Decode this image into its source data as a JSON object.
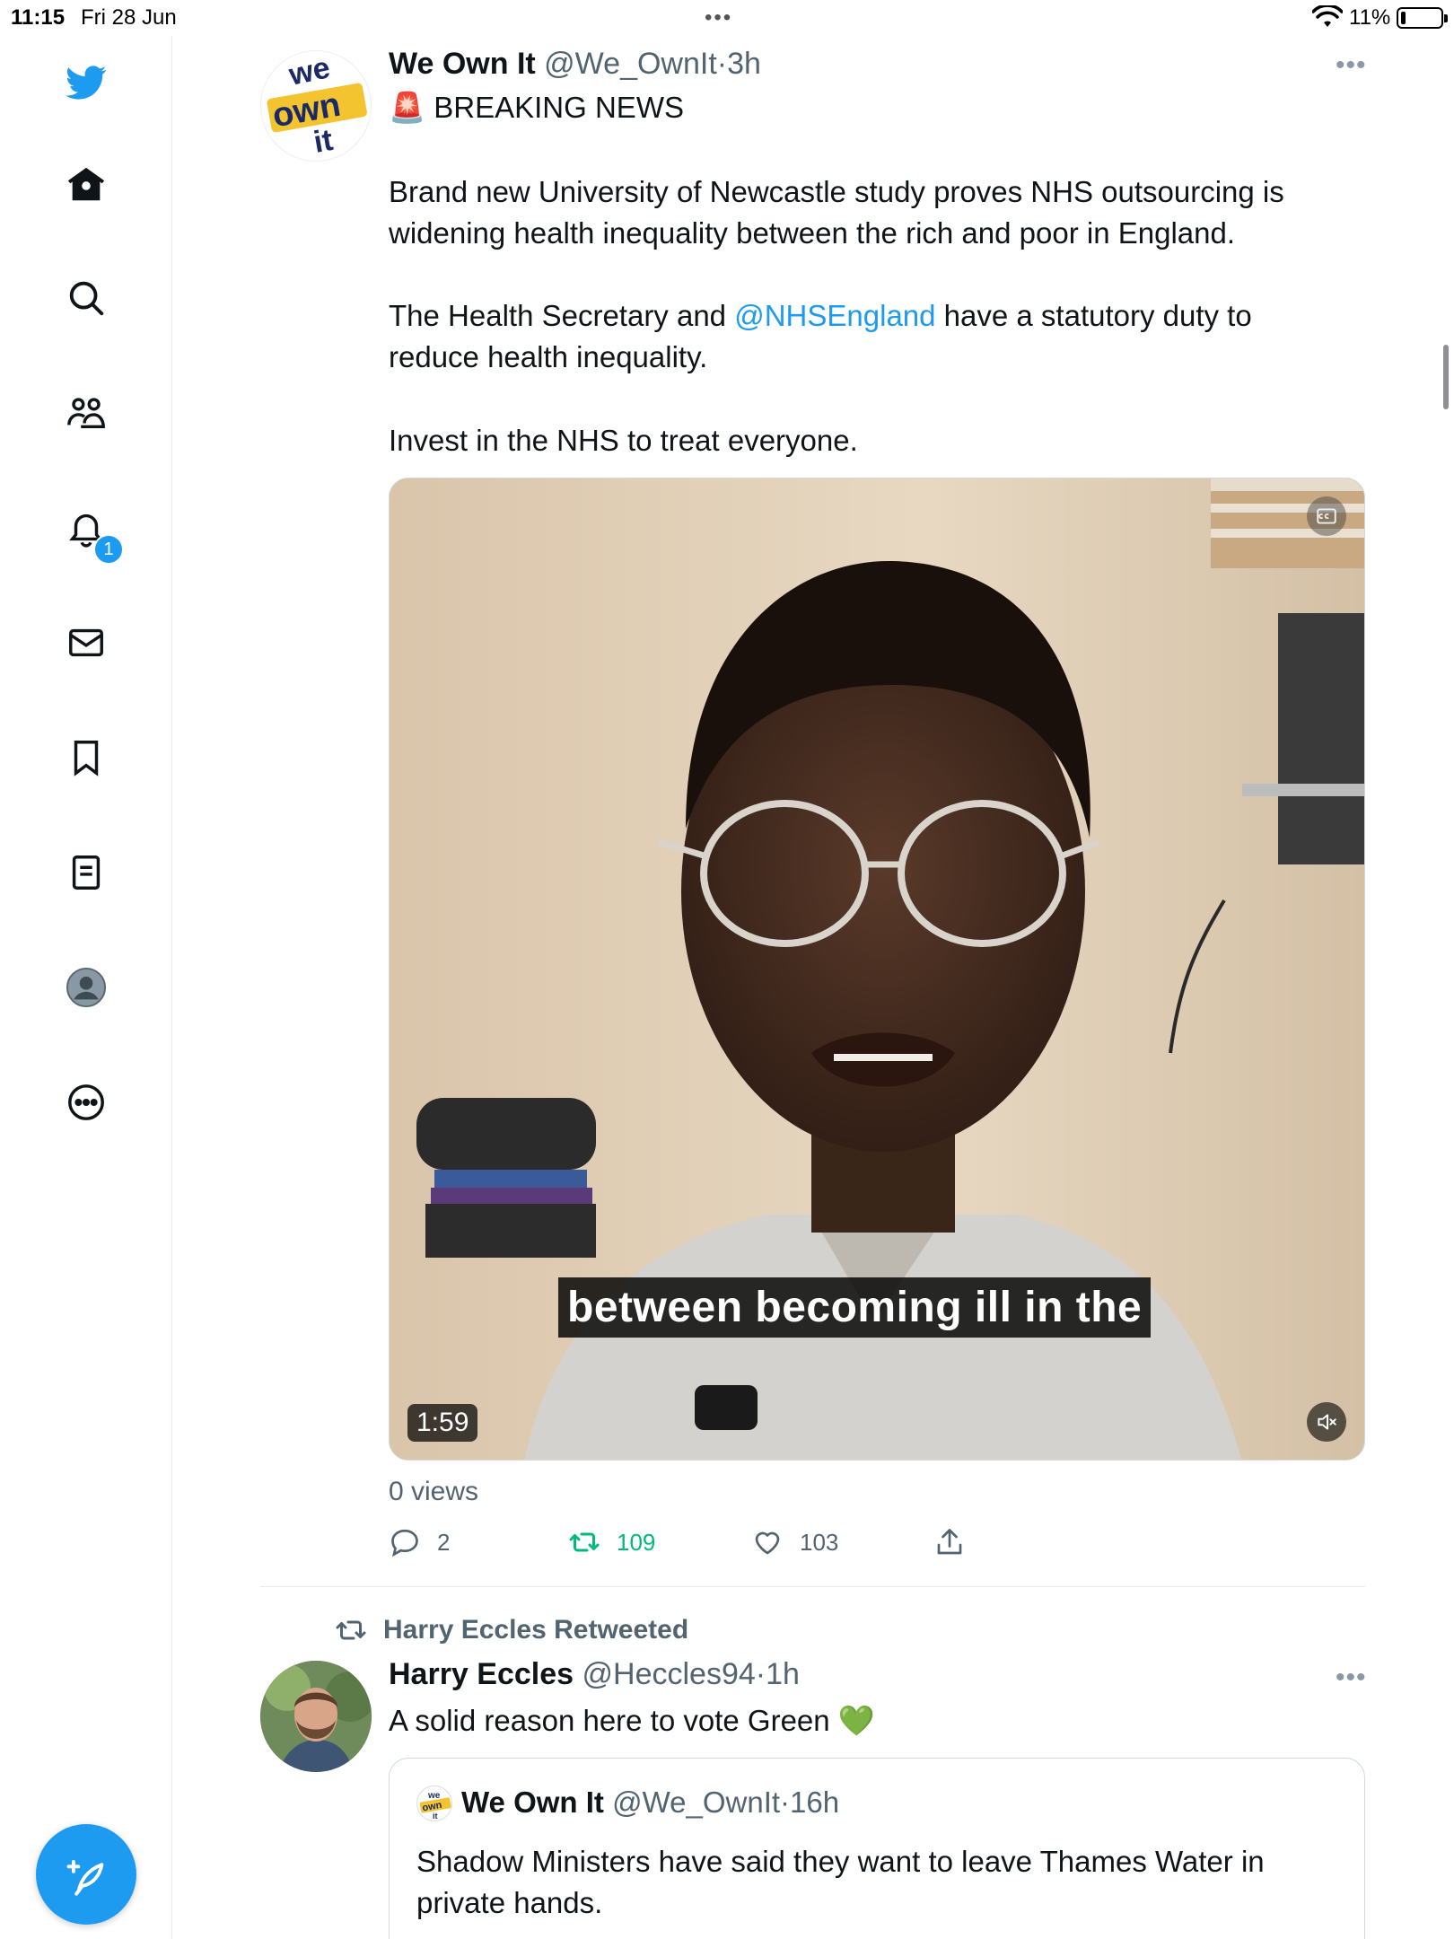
{
  "status_bar": {
    "time": "11:15",
    "date": "Fri 28 Jun",
    "multitask_dots": "•••",
    "battery_percent": "11%",
    "battery_level": 0.11
  },
  "sidebar": {
    "items": [
      {
        "name": "twitter-logo-icon"
      },
      {
        "name": "home-icon"
      },
      {
        "name": "search-icon"
      },
      {
        "name": "communities-icon"
      },
      {
        "name": "notifications-icon"
      },
      {
        "name": "messages-icon"
      },
      {
        "name": "bookmarks-icon"
      },
      {
        "name": "lists-icon"
      },
      {
        "name": "profile-icon"
      },
      {
        "name": "more-icon"
      }
    ],
    "notification_badge": "1"
  },
  "tweet1": {
    "author_name": "We Own It",
    "author_handle": "@We_OwnIt",
    "separator": "·",
    "time": "3h",
    "more": "•••",
    "avatar_text": [
      "we",
      "own",
      "it"
    ],
    "line1_emoji": "🚨",
    "line1_text": "BREAKING NEWS",
    "para1": "Brand new University of Newcastle study proves NHS outsourcing is widening health inequality between the rich and poor in England.",
    "para2_before": "The Health Secretary and ",
    "para2_mention": "@NHSEngland",
    "para2_after": " have a statutory duty to reduce health inequality.",
    "para3": "Invest in the NHS to treat everyone.",
    "video": {
      "duration": "1:59",
      "caption": "between becoming ill in the"
    },
    "views": "0 views",
    "stats": {
      "replies": "2",
      "retweets": "109",
      "likes": "103"
    }
  },
  "tweet2": {
    "retweeted_by": "Harry Eccles Retweeted",
    "author_name": "Harry Eccles",
    "author_handle": "@Heccles94",
    "separator": "·",
    "time": "1h",
    "more": "•••",
    "text": "A solid reason here to vote Green",
    "emoji": "💚",
    "quote": {
      "author_name": "We Own It",
      "author_handle": "@We_OwnIt",
      "separator": "·",
      "time": "16h",
      "text": "Shadow Ministers have said they want to leave Thames Water in private hands."
    }
  },
  "colors": {
    "accent": "#1d9bf0",
    "retweet_green": "#00ba7c",
    "secondary_text": "#536471"
  }
}
